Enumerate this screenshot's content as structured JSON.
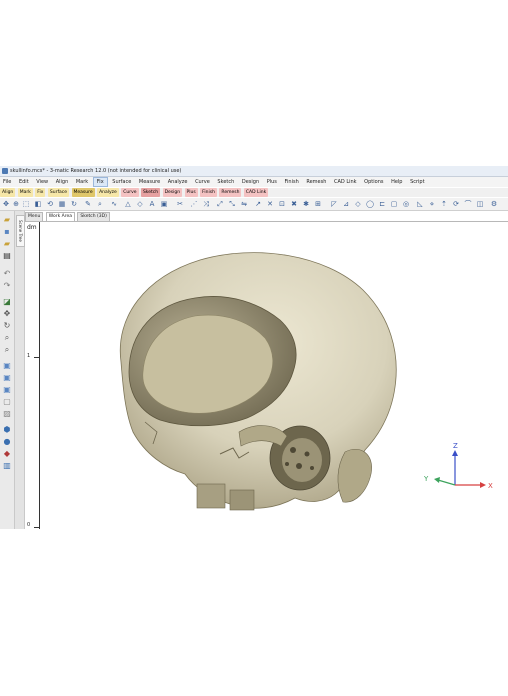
{
  "window": {
    "title": "skullinfo.mcs* - 3-matic Research 12.0 (not intended for clinical use)"
  },
  "menu": {
    "items": [
      "File",
      "Edit",
      "View",
      "Align",
      "Mark",
      "Fix",
      "Surface",
      "Measure",
      "Analyze",
      "Curve",
      "Sketch",
      "Design",
      "Plus",
      "Finish",
      "Remesh",
      "CAD Link",
      "Options",
      "Help",
      "Script"
    ],
    "active_index": 5
  },
  "ribbon_tabs": {
    "items": [
      "Align",
      "Mark",
      "Fix",
      "Surface",
      "Measure",
      "Analyze",
      "Curve",
      "Sketch",
      "Design",
      "Plus",
      "Finish",
      "Remesh",
      "CAD Link"
    ]
  },
  "side_panel": {
    "tab_label": "Scene Tree"
  },
  "doc_tabs": {
    "items": [
      "Menu",
      "Work Area",
      "Sketch (3D)"
    ],
    "selected_index": 1
  },
  "ruler": {
    "unit": "dm",
    "tick_labels": [
      "1",
      "0"
    ]
  },
  "triad": {
    "x_label": "X",
    "y_label": "Y",
    "z_label": "Z",
    "x_color": "#d64040",
    "y_color": "#3da35d",
    "z_color": "#3a4fc8"
  },
  "colors": {
    "bone": "#d8d2ba",
    "bone_shadow": "#8c8466",
    "toolbar_icon": "#3a5f96"
  }
}
